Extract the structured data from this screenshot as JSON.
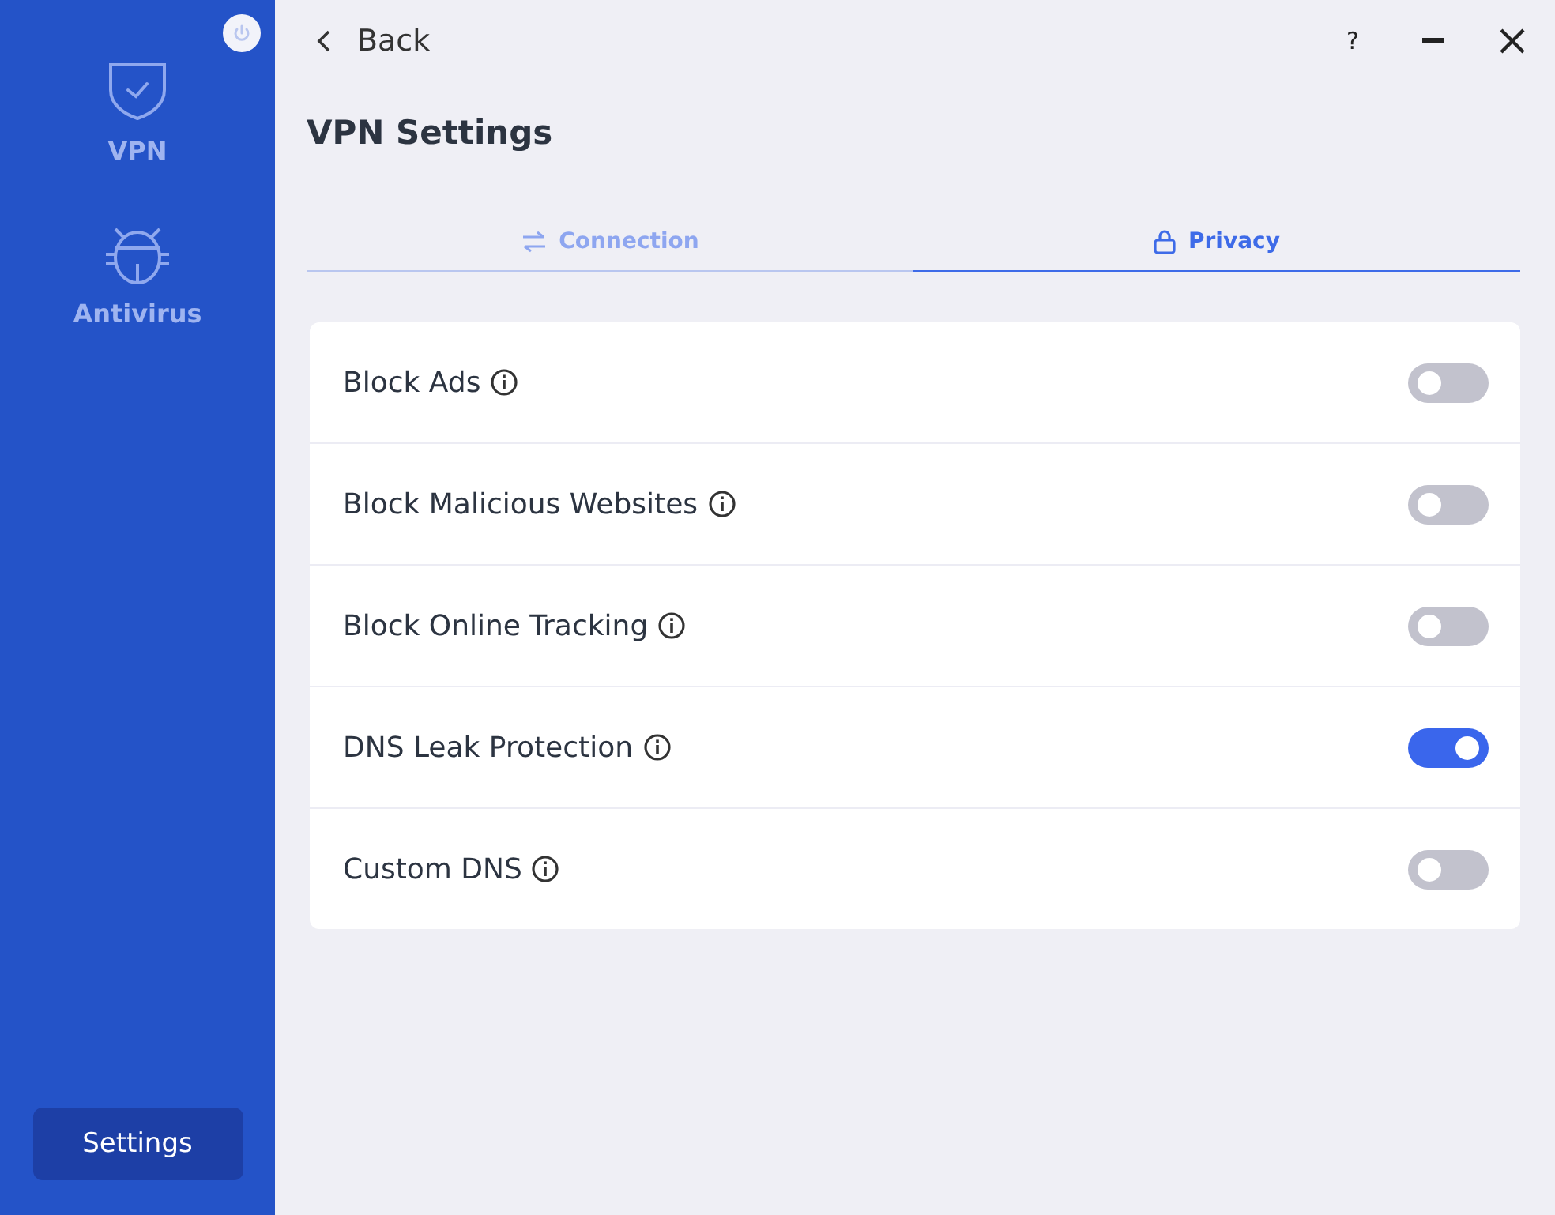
{
  "sidebar": {
    "items": [
      {
        "label": "VPN",
        "kind": "shield"
      },
      {
        "label": "Antivirus",
        "kind": "bug"
      }
    ],
    "settings_button": "Settings"
  },
  "header": {
    "back": "Back",
    "help": "?"
  },
  "title": "VPN Settings",
  "tabs": [
    {
      "label": "Connection",
      "kind": "arrows",
      "selected": false
    },
    {
      "label": "Privacy",
      "kind": "lock",
      "selected": true
    }
  ],
  "settings": [
    {
      "label": "Block Ads",
      "on": false
    },
    {
      "label": "Block Malicious Websites",
      "on": false
    },
    {
      "label": "Block Online Tracking",
      "on": false
    },
    {
      "label": "DNS Leak Protection",
      "on": true
    },
    {
      "label": "Custom DNS",
      "on": false
    }
  ]
}
